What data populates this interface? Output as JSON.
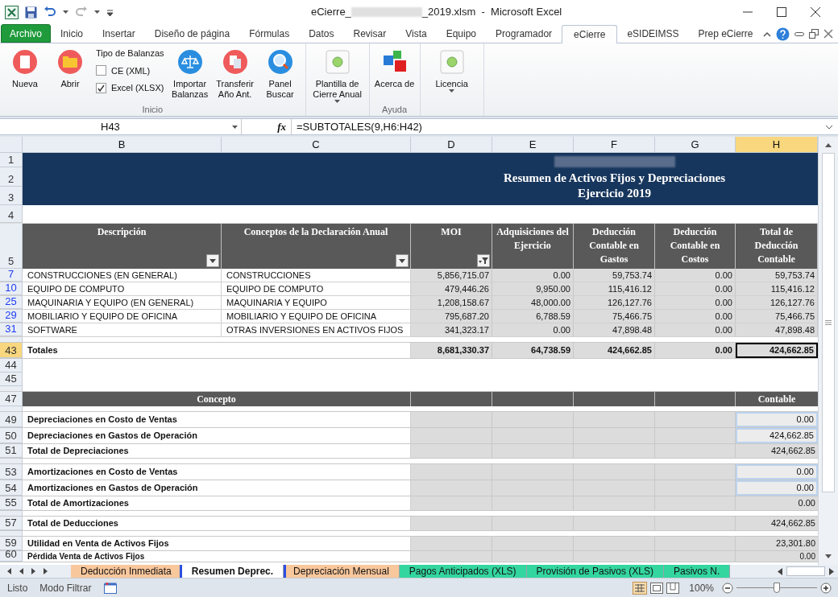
{
  "window": {
    "title_start": "eCierre_",
    "title_end": "_2019.xlsm  -  Microsoft Excel"
  },
  "ribbon_tabs": [
    {
      "label": "Archivo",
      "kind": "file",
      "selected": false
    },
    {
      "label": "Inicio",
      "kind": "tab",
      "selected": false
    },
    {
      "label": "Insertar",
      "kind": "tab",
      "selected": false
    },
    {
      "label": "Diseño de página",
      "kind": "tab",
      "selected": false
    },
    {
      "label": "Fórmulas",
      "kind": "tab",
      "selected": false
    },
    {
      "label": "Datos",
      "kind": "tab",
      "selected": false
    },
    {
      "label": "Revisar",
      "kind": "tab",
      "selected": false
    },
    {
      "label": "Vista",
      "kind": "tab",
      "selected": false
    },
    {
      "label": "Equipo",
      "kind": "tab",
      "selected": false
    },
    {
      "label": "Programador",
      "kind": "tab",
      "selected": false
    },
    {
      "label": "eCierre",
      "kind": "tab",
      "selected": true
    },
    {
      "label": "eSIDEIMSS",
      "kind": "tab",
      "selected": false
    },
    {
      "label": "Prep eCierre",
      "kind": "tab",
      "selected": false
    }
  ],
  "ribbon": {
    "groups": [
      {
        "label": "Inicio",
        "items": [
          {
            "kind": "large",
            "label": "Nueva"
          },
          {
            "kind": "large",
            "label": "Abrir"
          },
          {
            "kind": "options",
            "title": "Tipo de Balanzas",
            "options": [
              {
                "label": "CE (XML)",
                "checked": false
              },
              {
                "label": "Excel (XLSX)",
                "checked": true
              }
            ]
          },
          {
            "kind": "large",
            "label": "Importar Balanzas"
          },
          {
            "kind": "large",
            "label": "Transferir Año Ant."
          },
          {
            "kind": "large",
            "label": "Panel Buscar"
          }
        ]
      },
      {
        "items": [
          {
            "kind": "menu",
            "label": "Plantilla de Cierre Anual"
          }
        ]
      },
      {
        "label": "Ayuda",
        "items": [
          {
            "kind": "large",
            "label": "Acerca de"
          }
        ]
      },
      {
        "items": [
          {
            "kind": "menu",
            "label": "Licencia"
          }
        ]
      }
    ]
  },
  "formula_bar": {
    "name_box": "H43",
    "function_label": "fx",
    "formula": "=SUBTOTALES(9,H6:H42)"
  },
  "sheet": {
    "columns": [
      {
        "letter": "B",
        "selected": false
      },
      {
        "letter": "C",
        "selected": false
      },
      {
        "letter": "D",
        "selected": false
      },
      {
        "letter": "E",
        "selected": false
      },
      {
        "letter": "F",
        "selected": false
      },
      {
        "letter": "G",
        "selected": false
      },
      {
        "letter": "H",
        "selected": true
      }
    ],
    "banner": {
      "row_numbers": [
        "1",
        "2",
        "3"
      ],
      "lines": [
        "Resumen de Activos Fijos y Depreciaciones",
        "Ejercicio 2019"
      ]
    },
    "spacer_row": {
      "number": "4"
    },
    "header_row": {
      "number": "5",
      "cells": [
        {
          "label": "Descripción",
          "kind": "dropdown"
        },
        {
          "label": "Conceptos de la Declaración Anual",
          "kind": "dropdown"
        },
        {
          "label": "MOI",
          "kind": "filtered"
        },
        {
          "label": "Adquisiciones del Ejercicio",
          "kind": "plain"
        },
        {
          "label": "Deducción Contable en Gastos",
          "kind": "plain"
        },
        {
          "label": "Deducción Contable en Costos",
          "kind": "plain"
        },
        {
          "label": "Total de Deducción Contable",
          "kind": "plain"
        }
      ]
    },
    "rows": [
      {
        "kind": "asset",
        "number": "7",
        "filtered": true,
        "selected": false,
        "description": "CONSTRUCCIONES (EN GENERAL)",
        "concept": "CONSTRUCCIONES",
        "values": [
          "5,856,715.07",
          "0.00",
          "59,753.74",
          "0.00",
          "59,753.74"
        ]
      },
      {
        "kind": "asset",
        "number": "10",
        "filtered": true,
        "selected": false,
        "description": "EQUIPO DE COMPUTO",
        "concept": "EQUIPO DE COMPUTO",
        "values": [
          "479,446.26",
          "9,950.00",
          "115,416.12",
          "0.00",
          "115,416.12"
        ]
      },
      {
        "kind": "asset",
        "number": "25",
        "filtered": true,
        "selected": false,
        "description": "MAQUINARIA Y EQUIPO (EN GENERAL)",
        "concept": "MAQUINARIA Y EQUIPO",
        "values": [
          "1,208,158.67",
          "48,000.00",
          "126,127.76",
          "0.00",
          "126,127.76"
        ]
      },
      {
        "kind": "asset",
        "number": "29",
        "filtered": true,
        "selected": false,
        "description": "MOBILIARIO Y EQUIPO DE OFICINA",
        "concept": "MOBILIARIO Y EQUIPO DE OFICINA",
        "values": [
          "795,687.20",
          "6,788.59",
          "75,466.75",
          "0.00",
          "75,466.75"
        ]
      },
      {
        "kind": "asset",
        "number": "31",
        "filtered": true,
        "selected": false,
        "description": "SOFTWARE",
        "concept": "OTRAS INVERSIONES EN ACTIVOS FIJOS",
        "values": [
          "341,323.17",
          "0.00",
          "47,898.48",
          "0.00",
          "47,898.48"
        ]
      },
      {
        "kind": "gap"
      },
      {
        "kind": "total",
        "number": "43",
        "filtered": false,
        "selected": true,
        "label": "Totales",
        "values": [
          "8,681,330.37",
          "64,738.59",
          "424,662.85",
          "0.00",
          "424,662.85"
        ]
      },
      {
        "kind": "blank",
        "number": "44",
        "filtered": false,
        "selected": false
      },
      {
        "kind": "blank",
        "number": "45",
        "filtered": false,
        "selected": false
      },
      {
        "kind": "gap"
      },
      {
        "kind": "section",
        "number": "47",
        "filtered": false,
        "selected": false,
        "heading": "Concepto",
        "value_heading": "Contable"
      },
      {
        "kind": "gap"
      },
      {
        "kind": "line",
        "number": "49",
        "filtered": false,
        "selected": false,
        "input": true,
        "label": "Depreciaciones en Costo de Ventas",
        "value": "0.00"
      },
      {
        "kind": "line",
        "number": "50",
        "filtered": false,
        "selected": false,
        "input": true,
        "label": "Depreciaciones en Gastos de Operación",
        "value": "424,662.85"
      },
      {
        "kind": "line",
        "number": "51",
        "filtered": false,
        "selected": false,
        "input": false,
        "label": "Total de Depreciaciones",
        "value": "424,662.85"
      },
      {
        "kind": "gap"
      },
      {
        "kind": "line",
        "number": "53",
        "filtered": false,
        "selected": false,
        "input": true,
        "label": "Amortizaciones en Costo de Ventas",
        "value": "0.00"
      },
      {
        "kind": "line",
        "number": "54",
        "filtered": false,
        "selected": false,
        "input": true,
        "label": "Amortizaciones en Gastos de Operación",
        "value": "0.00"
      },
      {
        "kind": "line",
        "number": "55",
        "filtered": false,
        "selected": false,
        "input": false,
        "label": "Total de Amortizaciones",
        "value": "0.00"
      },
      {
        "kind": "gap"
      },
      {
        "kind": "line",
        "number": "57",
        "filtered": false,
        "selected": false,
        "input": false,
        "label": "Total de Deducciones",
        "value": "424,662.85"
      },
      {
        "kind": "gap"
      },
      {
        "kind": "line",
        "number": "59",
        "filtered": false,
        "selected": false,
        "input": false,
        "label": "Utilidad en Venta de Activos Fijos",
        "value": "23,301.80"
      },
      {
        "kind": "line",
        "number": "60",
        "filtered": false,
        "selected": false,
        "input": false,
        "label": "Pérdida Venta de Activos Fijos",
        "value": "0.00"
      }
    ]
  },
  "sheet_tabs": [
    {
      "label": "Deducción Inmediata",
      "color": "#f9c79c",
      "selected": false
    },
    {
      "label": "Resumen Deprec.",
      "color": "#ffffff",
      "selected": true
    },
    {
      "label": "Depreciación Mensual",
      "color": "#f9c79c",
      "selected": false
    },
    {
      "label": "Pagos Anticipados (XLS)",
      "color": "#34d6a0",
      "selected": false
    },
    {
      "label": "Provisión de Pasivos (XLS)",
      "color": "#34d6a0",
      "selected": false
    },
    {
      "label": "Pasivos N.",
      "color": "#34d6a0",
      "selected": false
    }
  ],
  "status_bar": {
    "ready": "Listo",
    "mode": "Modo Filtrar",
    "zoom": "100%",
    "zoom_slider": {
      "level": 0.5
    }
  }
}
